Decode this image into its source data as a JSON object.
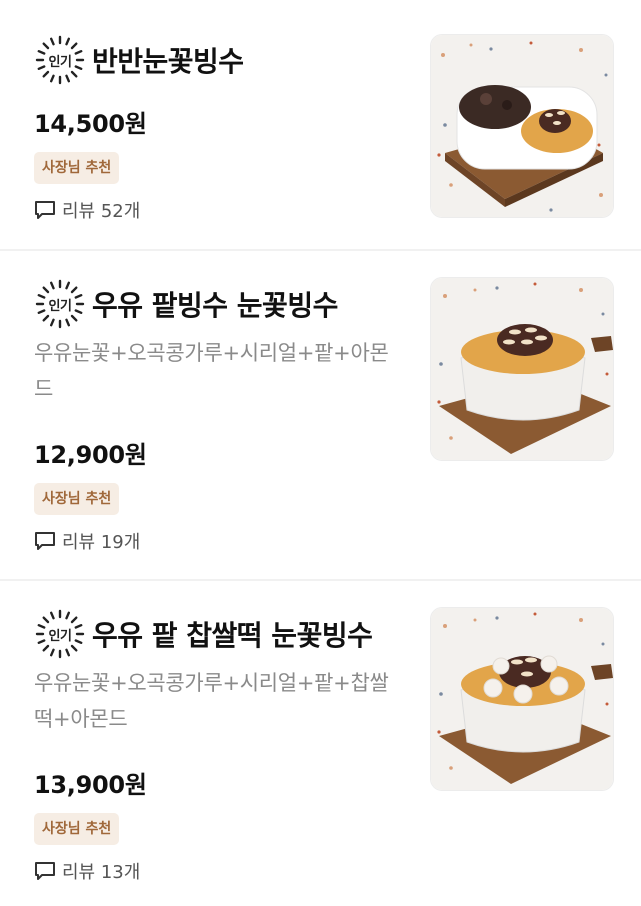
{
  "items": [
    {
      "badge": "인기",
      "title": "반반눈꽃빙수",
      "description": "",
      "price": "14,500원",
      "tag": "사장님 추천",
      "review_icon": "speech-bubble-icon",
      "review_label": "리뷰 52개",
      "image": "half-half-bingsu-photo"
    },
    {
      "badge": "인기",
      "title": "우유 팥빙수 눈꽃빙수",
      "description": "우유눈꽃+오곡콩가루+시리얼+팥+아몬드",
      "price": "12,900원",
      "tag": "사장님 추천",
      "review_icon": "speech-bubble-icon",
      "review_label": "리뷰 19개",
      "image": "milk-redbean-bingsu-photo"
    },
    {
      "badge": "인기",
      "title": "우유 팥 찹쌀떡 눈꽃빙수",
      "description": "우유눈꽃+오곡콩가루+시리얼+팥+찹쌀떡+아몬드",
      "price": "13,900원",
      "tag": "사장님 추천",
      "review_icon": "speech-bubble-icon",
      "review_label": "리뷰 13개",
      "image": "milk-redbean-ricecake-bingsu-photo"
    }
  ],
  "colors": {
    "title": "#111111",
    "description": "#8a8a8a",
    "owner_badge_bg": "#f6ede4",
    "owner_badge_text": "#a0683a",
    "divider": "#f1f1f1"
  }
}
